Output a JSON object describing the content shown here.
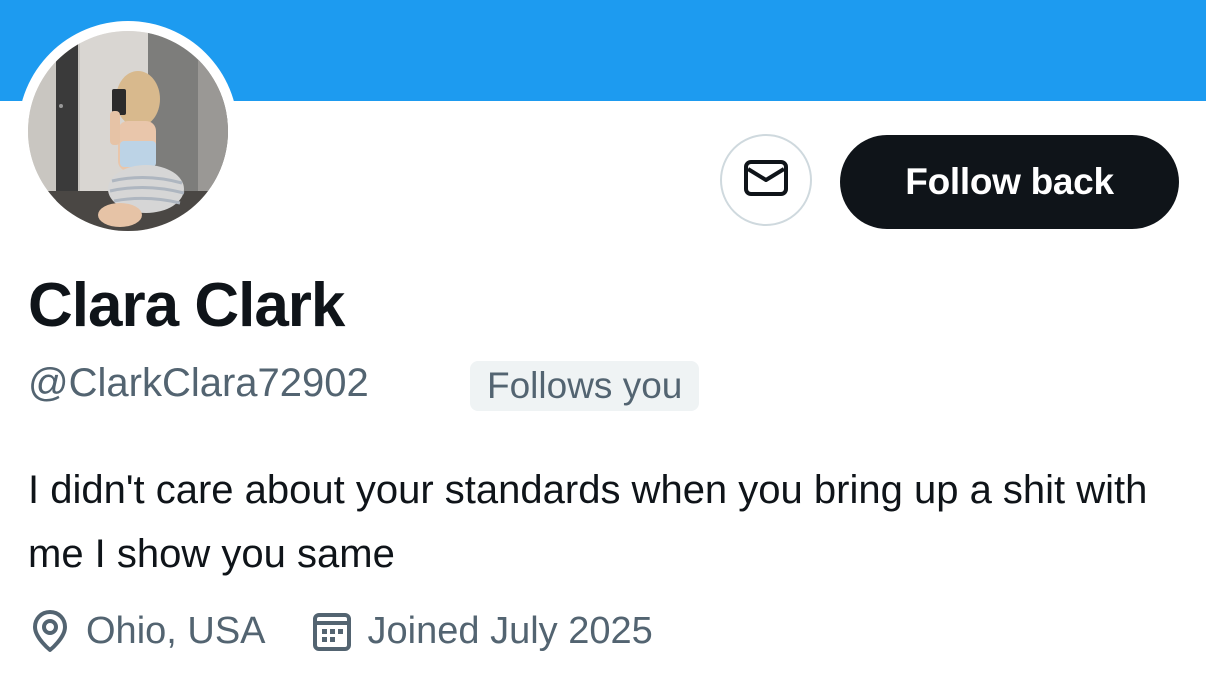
{
  "profile": {
    "display_name": "Clara Clark",
    "handle": "@ClarkClara72902",
    "follows_you_badge": "Follows you",
    "bio": "I didn't care about your standards when you bring up a shit with me I show you same",
    "location": "Ohio, USA",
    "joined": "Joined July 2025"
  },
  "actions": {
    "message_icon": "envelope-icon",
    "follow_back_label": "Follow back"
  },
  "icons": {
    "location": "location-pin-icon",
    "joined": "calendar-icon"
  },
  "colors": {
    "banner": "#1d9bf0",
    "primary_button": "#0f1419",
    "secondary_text": "#536471",
    "badge_bg": "#eff3f4"
  }
}
